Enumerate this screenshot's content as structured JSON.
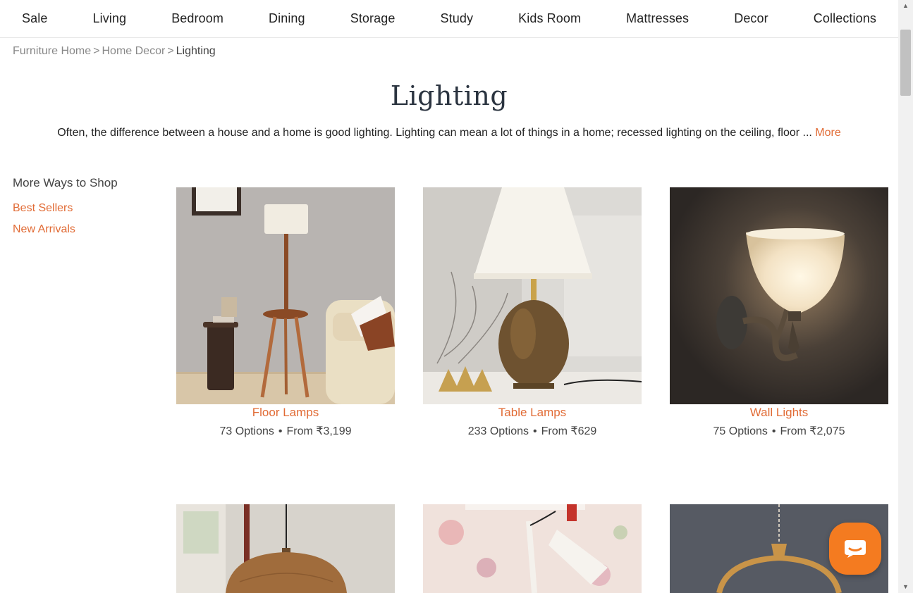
{
  "nav": [
    "Sale",
    "Living",
    "Bedroom",
    "Dining",
    "Storage",
    "Study",
    "Kids Room",
    "Mattresses",
    "Decor",
    "Collections"
  ],
  "breadcrumb": {
    "items": [
      "Furniture Home",
      "Home Decor"
    ],
    "current": "Lighting",
    "separator": ">"
  },
  "title": "Lighting",
  "description": {
    "text": "Often, the difference between a house and a home is good lighting. Lighting can mean a lot of things in a home; recessed lighting on the ceiling, floor ... ",
    "more": "More"
  },
  "sidebar": {
    "heading": "More Ways to Shop",
    "links": [
      "Best Sellers",
      "New Arrivals"
    ]
  },
  "products": [
    {
      "name": "Floor Lamps",
      "options": "73 Options",
      "dot": "•",
      "price": "From ₹3,199"
    },
    {
      "name": "Table Lamps",
      "options": "233 Options",
      "dot": "•",
      "price": "From ₹629"
    },
    {
      "name": "Wall Lights",
      "options": "75 Options",
      "dot": "•",
      "price": "From ₹2,075"
    }
  ],
  "colors": {
    "accent": "#e16b35",
    "chat": "#f47b20",
    "title": "#2b3440"
  },
  "icons": {
    "chat": "chat-bubble-icon",
    "scroll_up": "arrow-up-icon",
    "scroll_down": "arrow-down-icon"
  }
}
